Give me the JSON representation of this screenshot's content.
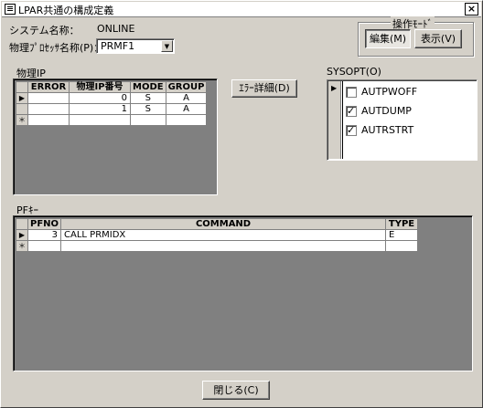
{
  "window": {
    "title": "LPAR共通の構成定義",
    "close_glyph": "×"
  },
  "system": {
    "label": "システム名称：",
    "value": "ONLINE"
  },
  "processor": {
    "label": "物理ﾌﾟﾛｾｯｻ名称(P)：",
    "value": "PRMF1"
  },
  "mode_group": {
    "title": "操作ﾓｰﾄﾞ",
    "edit_label": "編集(M)",
    "view_label": "表示(V)"
  },
  "physical_ip": {
    "label": "物理IP",
    "columns": [
      "ERROR",
      "物理IP番号",
      "MODE",
      "GROUP"
    ],
    "rows": [
      {
        "marker": "▶",
        "error": "",
        "ip": "0",
        "mode": "S",
        "group": "A"
      },
      {
        "marker": "",
        "error": "",
        "ip": "1",
        "mode": "S",
        "group": "A"
      },
      {
        "marker": "＊",
        "error": "",
        "ip": "",
        "mode": "",
        "group": ""
      }
    ]
  },
  "error_detail_label": "ｴﾗｰ詳細(D)",
  "sysopt": {
    "label": "SYSOPT(O)",
    "marker": "▶",
    "items": [
      {
        "label": "AUTPWOFF",
        "checked": ""
      },
      {
        "label": "AUTDUMP",
        "checked": "✓"
      },
      {
        "label": "AUTRSTRT",
        "checked": "✓"
      }
    ]
  },
  "pfkey": {
    "label": "PFｷｰ",
    "columns": [
      "PFNO",
      "COMMAND",
      "TYPE"
    ],
    "rows": [
      {
        "marker": "▶",
        "pfno": "3",
        "command": "CALL PRMIDX",
        "type": "E"
      },
      {
        "marker": "＊",
        "pfno": "",
        "command": "",
        "type": ""
      }
    ]
  },
  "close_label": "閉じる(C)"
}
